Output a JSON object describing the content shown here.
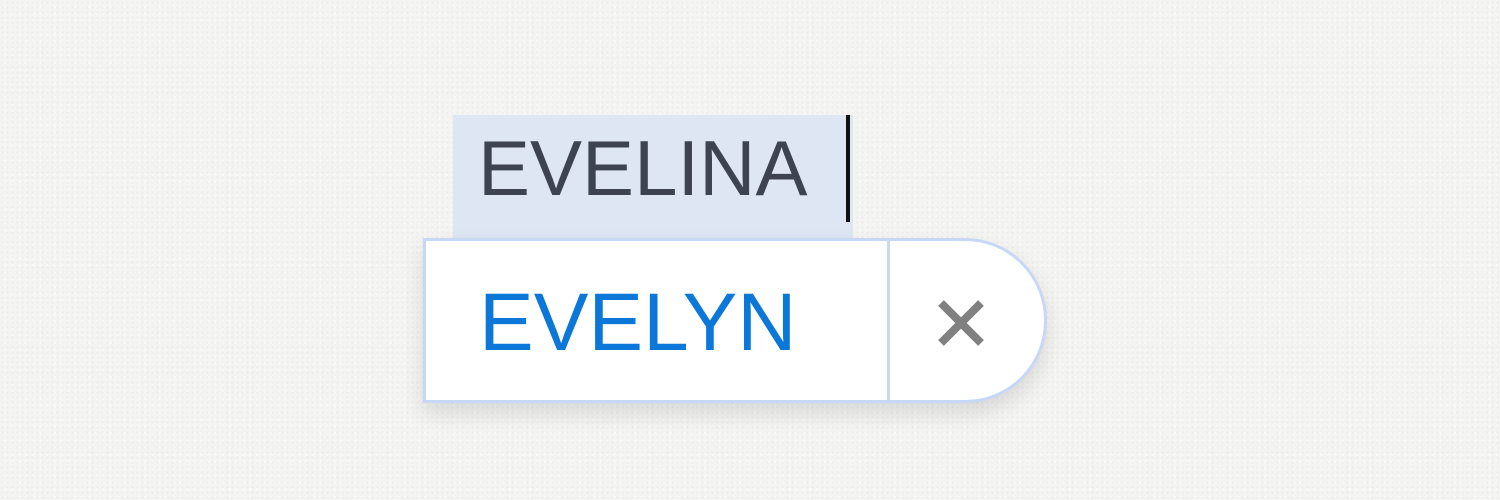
{
  "text_field": {
    "value": "EVELINA"
  },
  "autocorrect": {
    "suggestion": "EVELYN",
    "dismiss_icon": "close-icon"
  },
  "colors": {
    "field_highlight": "#dde6f2",
    "field_text": "#3e4352",
    "suggestion_text": "#0b77d9",
    "bubble_border": "#c7d8f6",
    "close_icon": "#808080"
  }
}
